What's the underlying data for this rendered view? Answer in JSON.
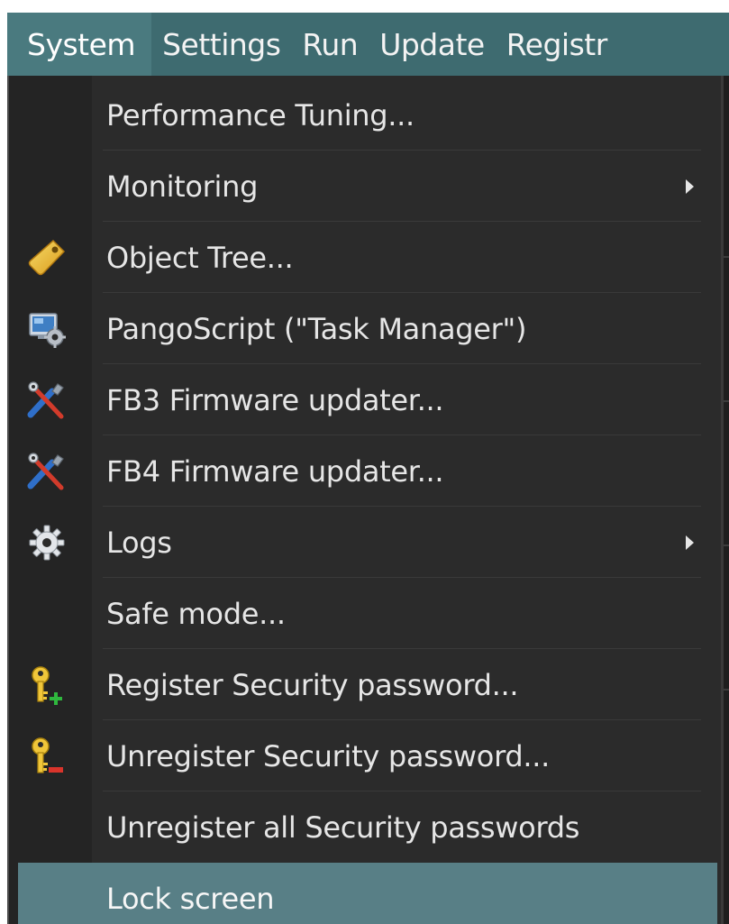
{
  "menubar": {
    "items": [
      {
        "label": "System",
        "active": true
      },
      {
        "label": "Settings"
      },
      {
        "label": "Run"
      },
      {
        "label": "Update"
      },
      {
        "label": "Registr"
      }
    ]
  },
  "dropdown": {
    "items": [
      {
        "label": "Performance Tuning...",
        "icon": null,
        "submenu": false
      },
      {
        "label": "Monitoring",
        "icon": null,
        "submenu": true
      },
      {
        "label": "Object Tree...",
        "icon": "tag-icon",
        "submenu": false
      },
      {
        "label": "PangoScript (\"Task Manager\")",
        "icon": "monitor-gear-icon",
        "submenu": false
      },
      {
        "label": "FB3 Firmware updater...",
        "icon": "tools-icon",
        "submenu": false
      },
      {
        "label": "FB4 Firmware updater...",
        "icon": "tools-icon",
        "submenu": false
      },
      {
        "label": "Logs",
        "icon": "gear-icon",
        "submenu": true
      },
      {
        "label": "Safe mode...",
        "icon": null,
        "submenu": false
      },
      {
        "label": "Register Security password...",
        "icon": "key-add-icon",
        "submenu": false
      },
      {
        "label": "Unregister Security password...",
        "icon": "key-remove-icon",
        "submenu": false
      },
      {
        "label": "Unregister all Security passwords",
        "icon": null,
        "submenu": false
      },
      {
        "label": "Lock screen",
        "icon": null,
        "submenu": false,
        "highlighted": true
      }
    ]
  },
  "colors": {
    "menubar_bg": "#3e6b70",
    "menu_bg": "#2b2b2b",
    "highlight": "#587f86",
    "text": "#e6e6e6"
  }
}
